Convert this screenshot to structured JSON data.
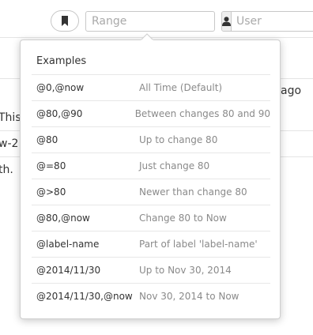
{
  "toolbar": {
    "range_placeholder": "Range",
    "user_placeholder": "User"
  },
  "background": {
    "line_ago": "ago",
    "line_this": "This",
    "line_w2": "w-2",
    "line_th": "th."
  },
  "examples_popover": {
    "title": "Examples",
    "items": [
      {
        "code": "@0,@now",
        "description": "All Time (Default)"
      },
      {
        "code": "@80,@90",
        "description": "Between changes 80 and 90"
      },
      {
        "code": "@80",
        "description": "Up to change 80"
      },
      {
        "code": "@=80",
        "description": "Just change 80"
      },
      {
        "code": "@>80",
        "description": "Newer than change 80"
      },
      {
        "code": "@80,@now",
        "description": "Change 80 to Now"
      },
      {
        "code": "@label-name",
        "description": "Part of label 'label-name'"
      },
      {
        "code": "@2014/11/30",
        "description": "Up to Nov 30, 2014"
      },
      {
        "code": "@2014/11/30,@now",
        "description": "Nov 30, 2014 to Now"
      }
    ]
  }
}
